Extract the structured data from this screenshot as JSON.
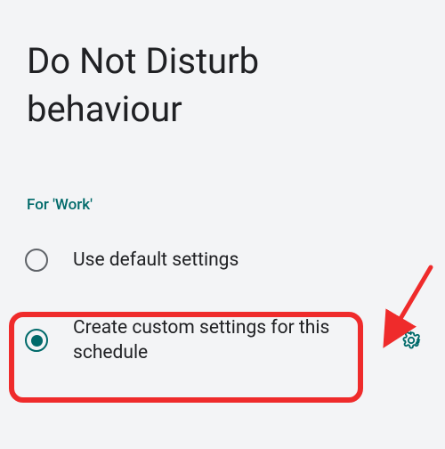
{
  "title": "Do Not Disturb behaviour",
  "section_label": "For 'Work'",
  "options": {
    "default": {
      "label": "Use default settings",
      "selected": false
    },
    "custom": {
      "label": "Create custom settings for this schedule",
      "selected": true
    }
  }
}
